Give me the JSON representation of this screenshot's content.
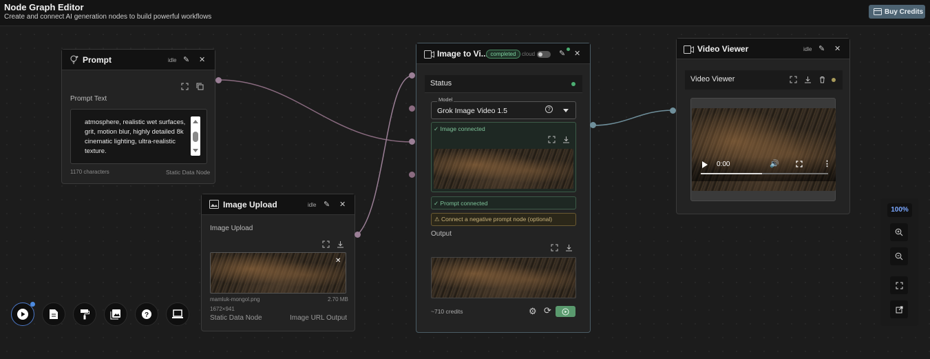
{
  "header": {
    "title": "Node Graph Editor",
    "subtitle": "Create and connect AI generation nodes to build powerful workflows",
    "buy_credits_label": "Buy Credits"
  },
  "prompt_node": {
    "title": "Prompt",
    "status": "idle",
    "field_label": "Prompt Text",
    "text": "atmosphere, realistic wet surfaces, grit, motion blur, highly detailed 8k cinematic lighting, ultra-realistic texture.",
    "char_count": "1170 characters",
    "node_type": "Static Data Node"
  },
  "image_upload_node": {
    "title": "Image Upload",
    "status": "idle",
    "field_label": "Image Upload",
    "file_name": "mamluk-mongol.png",
    "file_size": "2.70 MB",
    "dimensions": "1672×941",
    "node_type": "Static Data Node",
    "output_type": "Image URL Output"
  },
  "image_to_video_node": {
    "title": "Image to Vi...",
    "badge": "completed",
    "cloud_label": "cloud",
    "status_label": "Status",
    "model_label": "Model",
    "model_value": "Grok Image Video 1.5",
    "image_connected": "✓ Image connected",
    "prompt_connected": "✓ Prompt connected",
    "negative_hint": "⚠ Connect a negative prompt node (optional)",
    "output_label": "Output",
    "credits": "~710 credits"
  },
  "video_viewer_node": {
    "title": "Video Viewer",
    "status": "idle",
    "panel_title": "Video Viewer",
    "time": "0:00",
    "progress": 0.48
  },
  "zoom": {
    "level": "100%"
  },
  "colors": {
    "prompt_wire": "#8a6b80",
    "image_wire": "#9b7f96",
    "video_wire": "#6f8f9b",
    "status_dot": "#4caf72",
    "accent_blue": "#7aa7ff"
  }
}
